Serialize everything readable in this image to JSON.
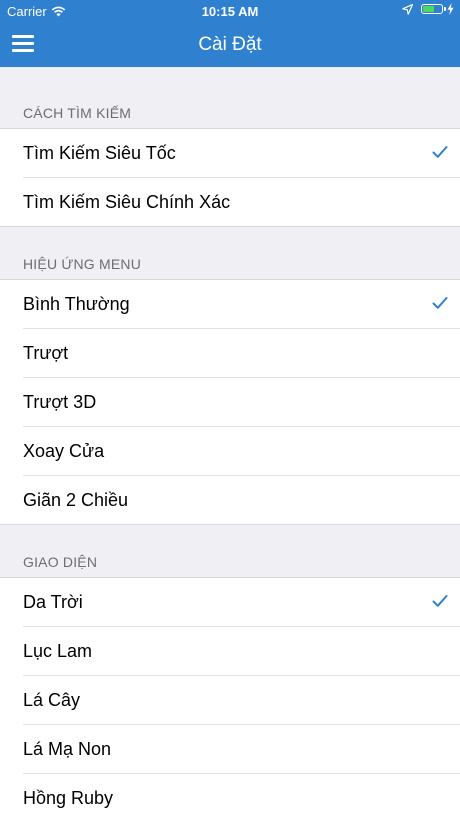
{
  "status_bar": {
    "carrier": "Carrier",
    "time": "10:15 AM",
    "battery_level": 0.55,
    "battery_color": "#4cd964"
  },
  "nav": {
    "title": "Cài Đặt",
    "menu_icon": "hamburger-menu-icon",
    "color": "#2f80cf"
  },
  "sections": [
    {
      "header": "CÁCH TÌM KIẾM",
      "items": [
        {
          "label": "Tìm Kiếm Siêu Tốc",
          "selected": true
        },
        {
          "label": "Tìm Kiếm Siêu Chính Xác",
          "selected": false
        }
      ]
    },
    {
      "header": "HIỆU ỨNG MENU",
      "items": [
        {
          "label": "Bình Thường",
          "selected": true
        },
        {
          "label": "Trượt",
          "selected": false
        },
        {
          "label": "Trượt 3D",
          "selected": false
        },
        {
          "label": "Xoay Cửa",
          "selected": false
        },
        {
          "label": "Giãn 2 Chiều",
          "selected": false
        }
      ]
    },
    {
      "header": "GIAO DIỆN",
      "items": [
        {
          "label": "Da Trời",
          "selected": true
        },
        {
          "label": "Lục Lam",
          "selected": false
        },
        {
          "label": "Lá Cây",
          "selected": false
        },
        {
          "label": "Lá Mạ Non",
          "selected": false
        },
        {
          "label": "Hồng Ruby",
          "selected": false
        }
      ]
    }
  ],
  "check_icon": "checkmark-icon",
  "check_color": "#2f80cf"
}
